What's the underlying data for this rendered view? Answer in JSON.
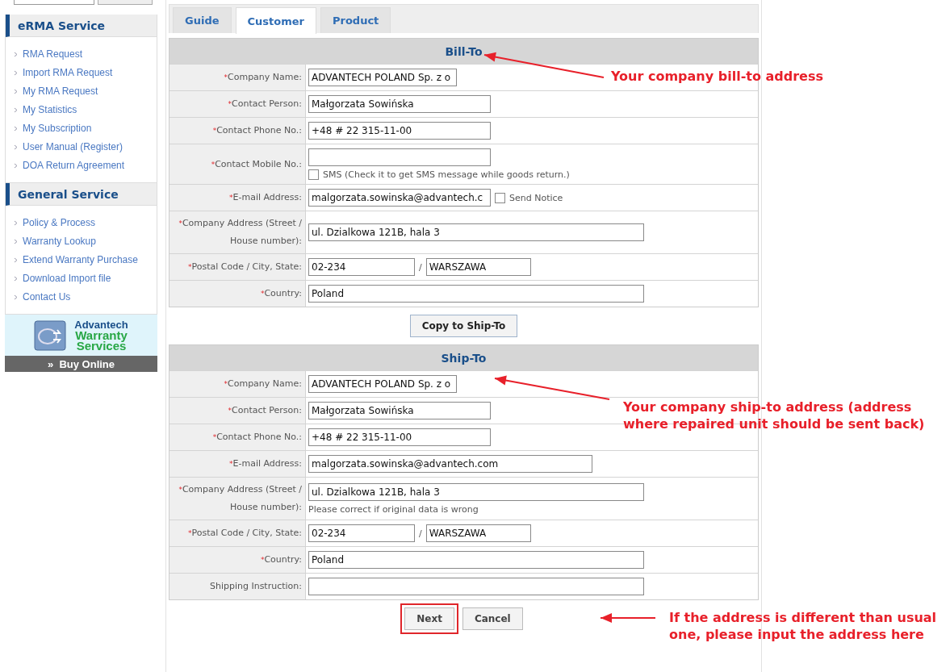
{
  "sidebar": {
    "sections": [
      {
        "title": "eRMA Service",
        "items": [
          "RMA Request",
          "Import RMA Request",
          "My RMA Request",
          "My Statistics",
          "My Subscription",
          "User Manual (Register)",
          "DOA Return Agreement"
        ]
      },
      {
        "title": "General Service",
        "items": [
          "Policy & Process",
          "Warranty Lookup",
          "Extend Warranty Purchase",
          "Download Import file",
          "Contact Us"
        ]
      }
    ],
    "banner": {
      "lines": [
        "Advantech",
        "Warranty",
        "Services"
      ],
      "buy_online": "»  Buy Online"
    }
  },
  "tabs": [
    {
      "label": "Guide",
      "selected": false
    },
    {
      "label": "Customer",
      "selected": true
    },
    {
      "label": "Product",
      "selected": false
    }
  ],
  "sections": [
    {
      "title": "Bill-To",
      "rows": [
        {
          "kind": "company",
          "label": "$^{*}$Company Name:",
          "values": [
            "ADVANTECH POLAND Sp. z o"
          ]
        },
        {
          "kind": "text",
          "label": "$^{*}$Contact Person:",
          "values": [
            "Małgorzata Sowińska"
          ]
        },
        {
          "kind": "text",
          "label": "$^{*}$Contact Phone No.:",
          "values": [
            "+48 # 22 315-11-00"
          ]
        },
        {
          "kind": "mobile",
          "label": "$^{*}$Contact Mobile No.:",
          "checkbox": {
            "label": "SMS (Check it to get SMS message while goods return.)",
            "checked": false
          }
        },
        {
          "kind": "email",
          "label": "$^{*}$E-mail Address:",
          "values": [
            "malgorzata.sowinska@advantech.c"
          ],
          "checkbox": {
            "label": "Send Notice",
            "checked": false
          }
        },
        {
          "kind": "address",
          "label": "$^{*}$Company Address (Street / House number):",
          "values": [
            "ul. Dzialkowa 121B, hala 3"
          ]
        },
        {
          "kind": "postal",
          "label": "$^{*}$Postal Code / City, State:",
          "values": [
            "02-234",
            "WARSZAWA"
          ],
          "separator": "/"
        },
        {
          "kind": "address",
          "label": "$^{*}$Country:",
          "values": [
            "Poland"
          ]
        }
      ]
    },
    {
      "title": "Ship-To",
      "rows": [
        {
          "kind": "company",
          "label": "$^{*}$Company Name:",
          "values": [
            "ADVANTECH POLAND Sp. z o"
          ]
        },
        {
          "kind": "text",
          "label": "$^{*}$Contact Person:",
          "values": [
            "Małgorzata Sowińska"
          ]
        },
        {
          "kind": "text",
          "label": "$^{*}$Contact Phone No.:",
          "values": [
            "+48 # 22 315-11-00"
          ]
        },
        {
          "kind": "email",
          "label": "$^{*}$E-mail Address:",
          "values": [
            "malgorzata.sowinska@advantech.com"
          ]
        },
        {
          "kind": "address",
          "label": "$^{*}$Company Address (Street / House number):",
          "values": [
            "ul. Dzialkowa 121B, hala 3"
          ],
          "note": "Please correct if original data is wrong"
        },
        {
          "kind": "postal",
          "label": "$^{*}$Postal Code / City, State:",
          "values": [
            "02-234",
            "WARSZAWA"
          ],
          "separator": "/"
        },
        {
          "kind": "address",
          "label": "$^{*}$Country:",
          "values": [
            "Poland"
          ]
        },
        {
          "kind": "address",
          "label": "Shipping Instruction:"
        }
      ]
    }
  ],
  "copy_button": "Copy to Ship-To",
  "buttons": [
    {
      "label": "Next",
      "highlighted": true
    },
    {
      "label": "Cancel",
      "highlighted": false
    }
  ],
  "annotations": [
    "Your company bill-to address",
    "Your company ship-to address (address where repaired unit should be sent back)",
    "If the address is different than usual one, please input the address here"
  ]
}
